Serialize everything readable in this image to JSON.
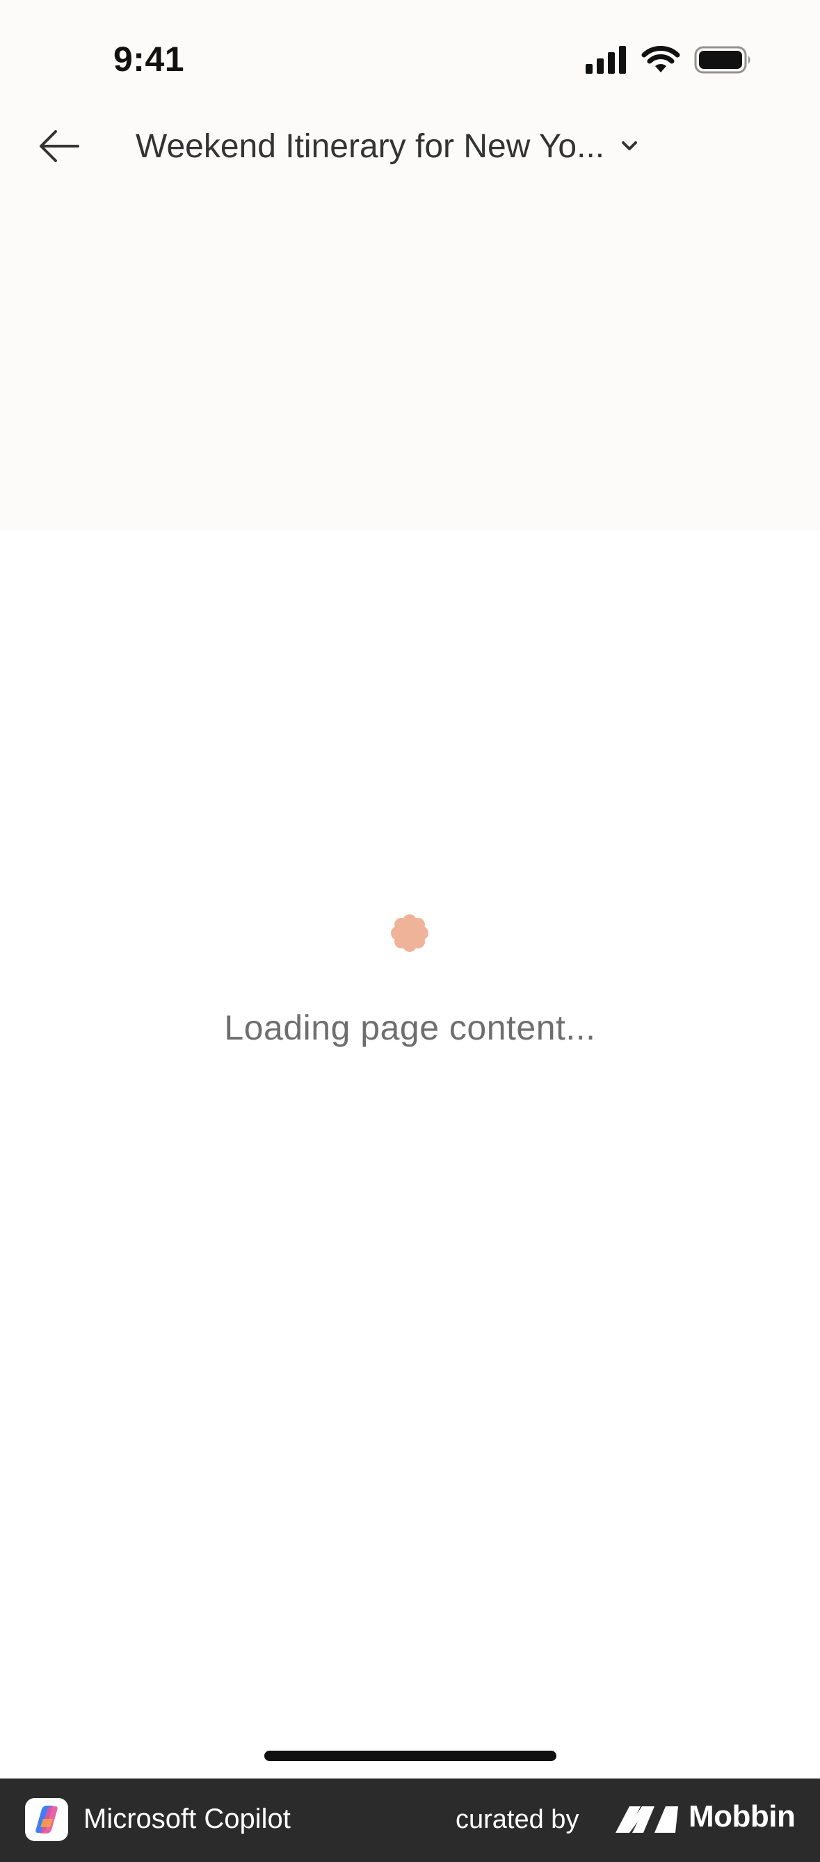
{
  "status_bar": {
    "time": "9:41",
    "icons": [
      "signal-icon",
      "wifi-icon",
      "battery-icon"
    ]
  },
  "nav": {
    "back_icon": "arrow-left-icon",
    "title": "Weekend Itinerary for New Yo...",
    "dropdown_icon": "chevron-down-icon"
  },
  "content": {
    "loading_icon": "flower-spinner-icon",
    "loading_text": "Loading page content..."
  },
  "footer": {
    "app_name": "Microsoft Copilot",
    "curated_by": "curated by",
    "brand": "Mobbin"
  },
  "colors": {
    "header_background": "#fcfbfa",
    "page_background": "#ffffff",
    "loading_icon": "#efb39a",
    "footer_background": "#2b2b2b"
  }
}
